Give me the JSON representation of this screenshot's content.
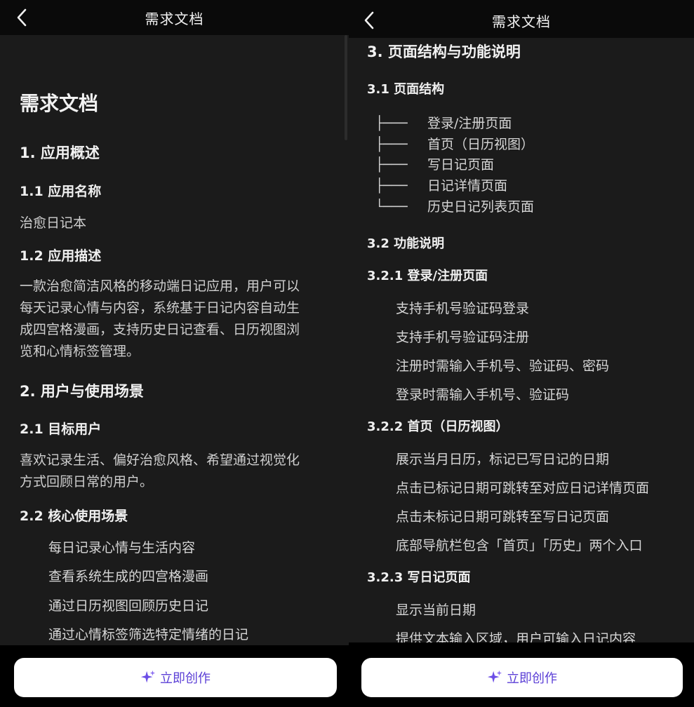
{
  "accent_color": "#6b4de6",
  "left": {
    "header_title": "需求文档",
    "doc_title": "需求文档",
    "s1": "1. 应用概述",
    "s1_1": "1.1 应用名称",
    "app_name": "治愈日记本",
    "s1_2": "1.2 应用描述",
    "desc_lines": [
      "一款治愈简洁风格的移动端日记应用，用户可以",
      "每天记录心情与内容，系统基于日记内容自动生",
      "成四宫格漫画，支持历史日记查看、日历视图浏",
      "览和心情标签管理。"
    ],
    "s2": "2. 用户与使用场景",
    "s2_1": "2.1 目标用户",
    "target_lines": [
      "喜欢记录生活、偏好治愈风格、希望通过视觉化",
      "方式回顾日常的用户。"
    ],
    "s2_2": "2.2 核心使用场景",
    "scenarios": [
      "每日记录心情与生活内容",
      "查看系统生成的四宫格漫画",
      "通过日历视图回顾历史日记",
      "通过心情标签筛选特定情绪的日记"
    ],
    "create_label": "立即创作"
  },
  "right": {
    "header_title": "需求文档",
    "s3": "3. 页面结构与功能说明",
    "s3_1": "3.1 页面结构",
    "tree": [
      {
        "prefix": "├───",
        "label": "登录/注册页面"
      },
      {
        "prefix": "├───",
        "label": "首页（日历视图）"
      },
      {
        "prefix": "├───",
        "label": "写日记页面"
      },
      {
        "prefix": "├───",
        "label": "日记详情页面"
      },
      {
        "prefix": "└───",
        "label": "历史日记列表页面"
      }
    ],
    "s3_2": "3.2 功能说明",
    "s3_2_1": "3.2.1 登录/注册页面",
    "login_items": [
      "支持手机号验证码登录",
      "支持手机号验证码注册",
      "注册时需输入手机号、验证码、密码",
      "登录时需输入手机号、验证码"
    ],
    "s3_2_2": "3.2.2 首页（日历视图）",
    "home_items": [
      "展示当月日历，标记已写日记的日期",
      "点击已标记日期可跳转至对应日记详情页面",
      "点击未标记日期可跳转至写日记页面",
      "底部导航栏包含「首页」「历史」两个入口"
    ],
    "s3_2_3": "3.2.3 写日记页面",
    "write_items": [
      "显示当前日期",
      "提供文本输入区域，用户可输入日记内容"
    ],
    "create_label": "立即创作"
  }
}
